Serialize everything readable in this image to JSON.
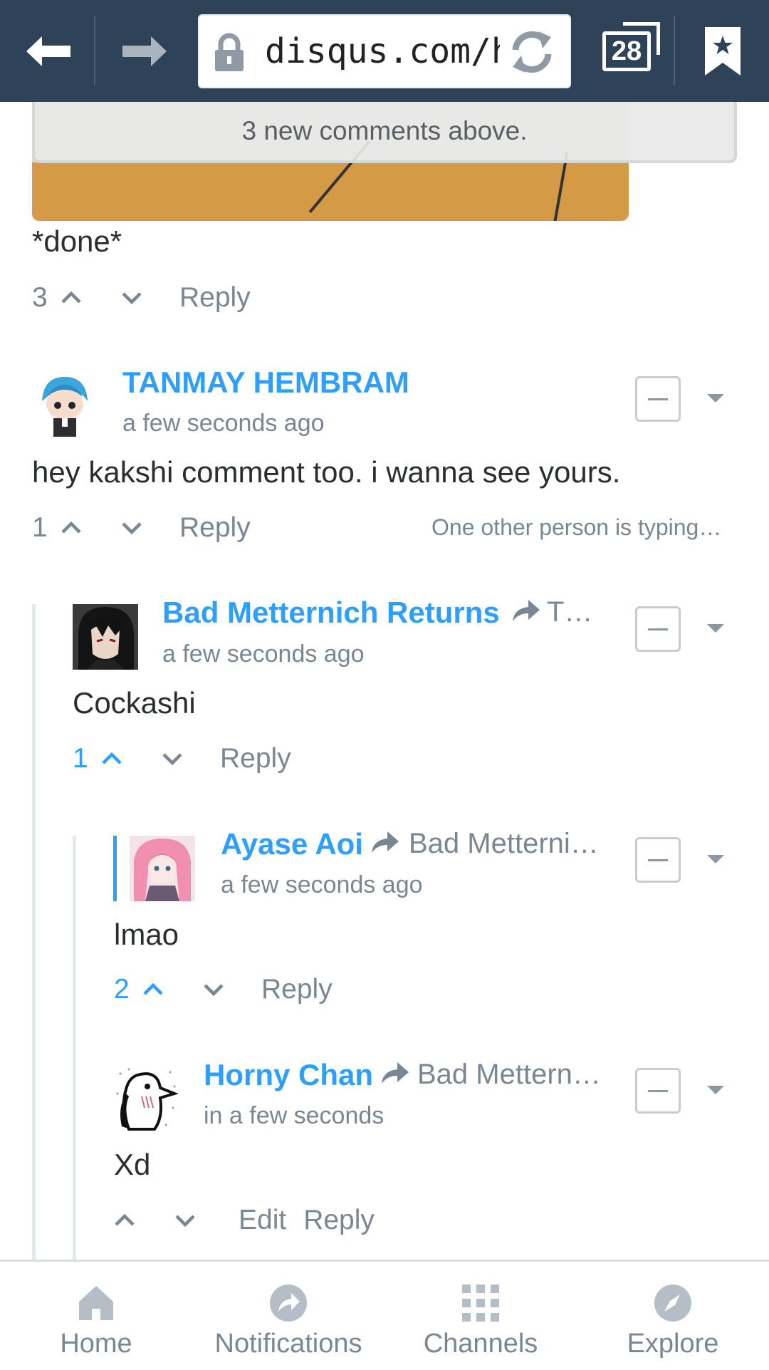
{
  "browser": {
    "url": "disqus.com/ho",
    "tab_count": "28",
    "icons": [
      "back-arrow-icon",
      "forward-arrow-icon",
      "lock-icon",
      "refresh-icon",
      "tabs-icon",
      "bookmark-icon"
    ]
  },
  "banner": {
    "text": "3 new comments above."
  },
  "comments": [
    {
      "body": "*done*",
      "votes": "3",
      "reply_label": "Reply"
    },
    {
      "author": "TANMAY HEMBRAM",
      "time": "a few seconds ago",
      "body": "hey kakshi comment too. i wanna see yours.",
      "votes": "1",
      "reply_label": "Reply",
      "typing": "One other person is typing…"
    },
    {
      "author": "Bad Metternich Returns",
      "reply_to": "T…",
      "time": "a few seconds ago",
      "body": "Cockashi",
      "votes": "1",
      "reply_label": "Reply"
    },
    {
      "author": "Ayase Aoi",
      "reply_to": "Bad Metterni…",
      "time": "a few seconds ago",
      "body": "lmao",
      "votes": "2",
      "reply_label": "Reply"
    },
    {
      "author": "Horny Chan",
      "reply_to": "Bad Mettern…",
      "time": "in a few seconds",
      "body": "Xd",
      "edit_label": "Edit",
      "reply_label": "Reply"
    }
  ],
  "nav": {
    "items": [
      {
        "label": "Home",
        "icon": "home-icon"
      },
      {
        "label": "Notifications",
        "icon": "notifications-icon"
      },
      {
        "label": "Channels",
        "icon": "channels-icon"
      },
      {
        "label": "Explore",
        "icon": "explore-icon"
      }
    ]
  },
  "colors": {
    "accent": "#2e9fff",
    "topbar": "#2f4358",
    "muted": "#7a8792"
  }
}
